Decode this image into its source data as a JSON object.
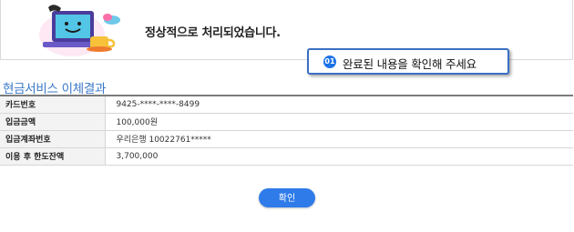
{
  "banner": {
    "message": "정상적으로 처리되었습니다."
  },
  "callout": {
    "number": "01",
    "text": "완료된 내용을 확인해 주세요"
  },
  "section": {
    "title": "현금서비스 이체결과"
  },
  "result_rows": [
    {
      "label": "카드번호",
      "value": "9425-****-****-8499"
    },
    {
      "label": "입금금액",
      "value": "100,000원"
    },
    {
      "label": "입금계좌번호",
      "value": "우리은행 10022761*****"
    },
    {
      "label": "이용 후 한도잔액",
      "value": "3,700,000"
    }
  ],
  "buttons": {
    "confirm_label": "확인"
  },
  "colors": {
    "accent": "#2f7bea",
    "title_blue": "#3a78c9",
    "callout_border": "#3a6fc3"
  }
}
